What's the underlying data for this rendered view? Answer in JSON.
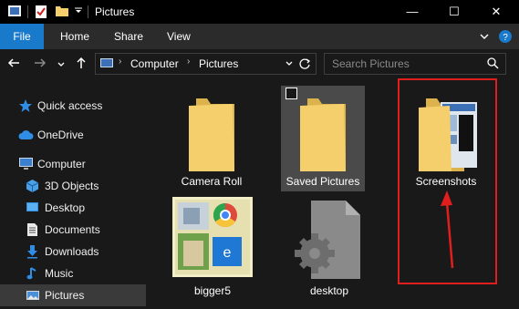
{
  "window": {
    "title": "Pictures",
    "minimize": "—",
    "maximize": "☐",
    "close": "✕"
  },
  "ribbon": {
    "file": "File",
    "tabs": [
      "Home",
      "Share",
      "View"
    ]
  },
  "address": {
    "crumbs": [
      "Computer",
      "Pictures"
    ]
  },
  "search": {
    "placeholder": "Search Pictures"
  },
  "sidebar": {
    "items": [
      {
        "label": "Quick access",
        "icon": "star-icon"
      },
      {
        "label": "OneDrive",
        "icon": "cloud-icon"
      },
      {
        "label": "Computer",
        "icon": "monitor-icon"
      },
      {
        "label": "3D Objects",
        "icon": "cube-icon"
      },
      {
        "label": "Desktop",
        "icon": "desktop-icon"
      },
      {
        "label": "Documents",
        "icon": "documents-icon"
      },
      {
        "label": "Downloads",
        "icon": "download-icon"
      },
      {
        "label": "Music",
        "icon": "music-icon"
      },
      {
        "label": "Pictures",
        "icon": "pictures-icon"
      }
    ]
  },
  "files": [
    {
      "name": "Camera Roll",
      "type": "folder"
    },
    {
      "name": "Saved Pictures",
      "type": "folder"
    },
    {
      "name": "Screenshots",
      "type": "folder"
    },
    {
      "name": "bigger5",
      "type": "image"
    },
    {
      "name": "desktop",
      "type": "settings-file"
    }
  ],
  "colors": {
    "accent": "#1979ca",
    "annotation": "#e11e1e",
    "folder": "#f4cf6c"
  }
}
